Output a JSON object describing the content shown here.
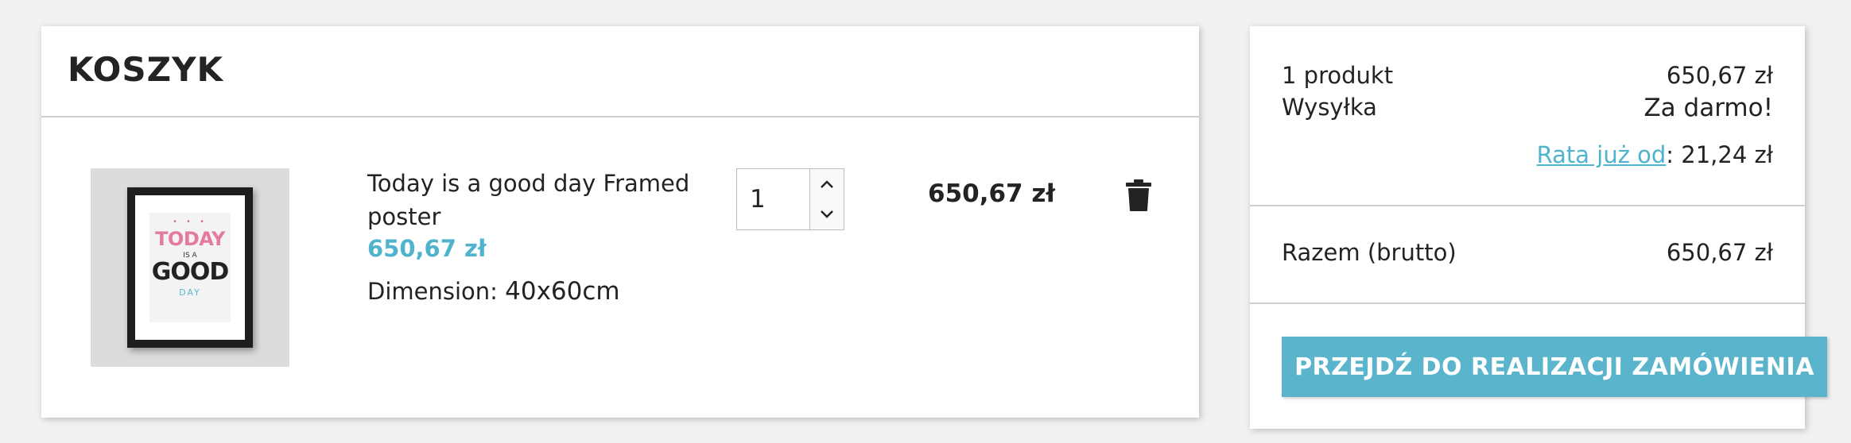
{
  "cart": {
    "title": "KOSZYK",
    "item": {
      "name": "Today is a good day Framed poster",
      "price": "650,67 zł",
      "attribute_label": "Dimension: ",
      "attribute_value": "40x60cm",
      "quantity": "1",
      "line_total": "650,67 zł",
      "image_art": {
        "today": "TODAY",
        "is_a": "IS A",
        "good": "GOOD",
        "day": "DAY"
      }
    }
  },
  "summary": {
    "products_label": "1 produkt",
    "products_value": "650,67 zł",
    "shipping_label": "Wysyłka",
    "shipping_value": "Za darmo!",
    "installment_link": "Rata już od",
    "installment_value": ": 21,24 zł",
    "total_label": "Razem (brutto)",
    "total_value": "650,67 zł",
    "checkout_label": "PRZEJDŹ DO REALIZACJI ZAMÓWIENIA"
  },
  "icons": {
    "qty_up": "chevron-up-icon",
    "qty_down": "chevron-down-icon",
    "remove": "trash-icon"
  },
  "colors": {
    "accent": "#4fb3cd",
    "button": "#5ab4cc",
    "background": "#f1f1f1"
  }
}
